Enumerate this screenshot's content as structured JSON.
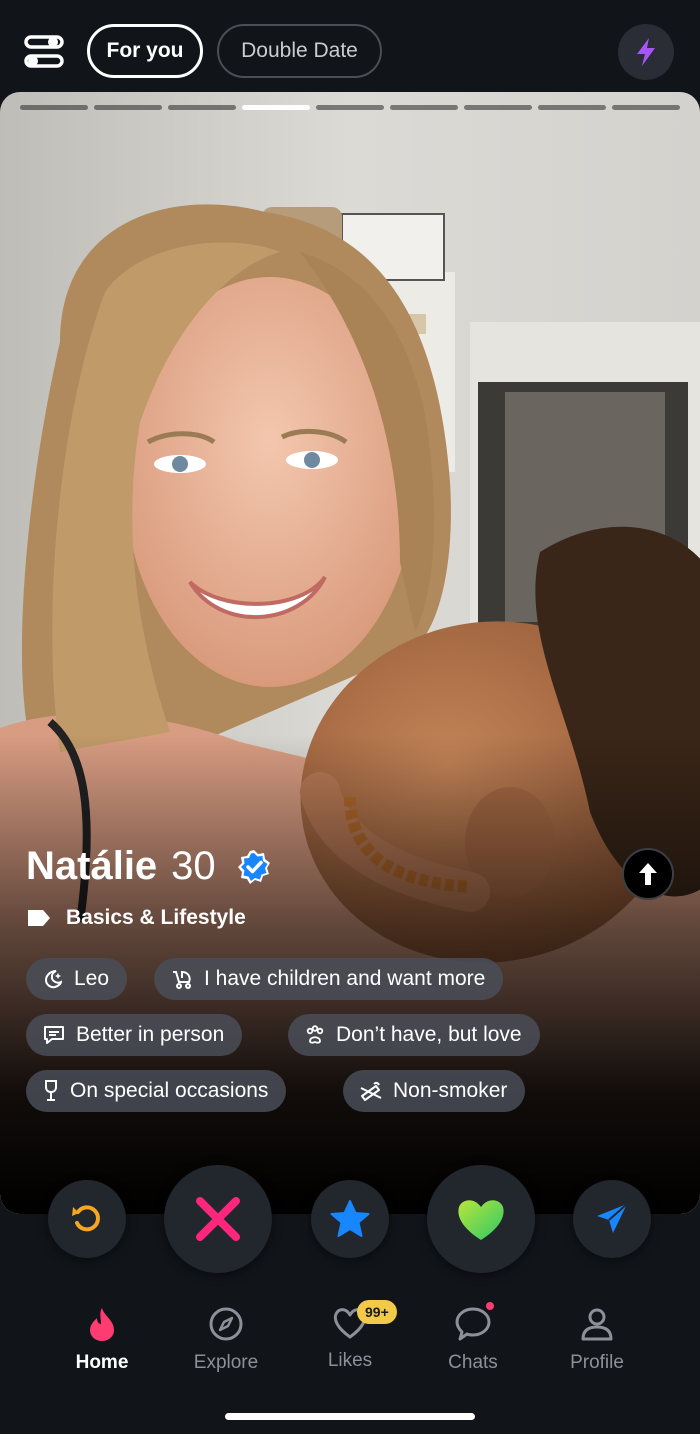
{
  "header": {
    "tabs": [
      {
        "label": "For you",
        "active": true
      },
      {
        "label": "Double Date",
        "active": false
      }
    ],
    "icons": {
      "filter": "sliders-icon",
      "boost": "lightning-icon"
    }
  },
  "profile": {
    "photo_count": 9,
    "current_photo": 4,
    "name": "Natálie",
    "age": "30",
    "verified": true,
    "section_label": "Basics & Lifestyle",
    "chips": [
      {
        "icon": "moon-icon",
        "label": "Leo"
      },
      {
        "icon": "stroller-icon",
        "label": "I have children and want more"
      },
      {
        "icon": "chat-bubble-icon",
        "label": "Better in person"
      },
      {
        "icon": "paw-icon",
        "label": "Don’t have, but love"
      },
      {
        "icon": "wine-glass-icon",
        "label": "On special occasions"
      },
      {
        "icon": "no-smoking-icon",
        "label": "Non-smoker"
      }
    ]
  },
  "actions": [
    "rewind-icon",
    "nope-icon",
    "super-like-icon",
    "like-icon",
    "boost-send-icon"
  ],
  "nav": {
    "items": [
      {
        "label": "Home",
        "icon": "flame-icon",
        "active": true
      },
      {
        "label": "Explore",
        "icon": "compass-icon",
        "active": false
      },
      {
        "label": "Likes",
        "icon": "heart-icon",
        "active": false,
        "badge": "99+"
      },
      {
        "label": "Chats",
        "icon": "chat-icon",
        "active": false,
        "dot": true
      },
      {
        "label": "Profile",
        "icon": "person-icon",
        "active": false
      }
    ]
  },
  "colors": {
    "background": "#111418",
    "nope": "#fd267d",
    "super_like": "#1786ff",
    "like": "#4cd964",
    "rewind": "#f5a623",
    "boost": "#a855f7",
    "tinder_flame": "#fe3c72",
    "badge": "#f3c94a",
    "verified": "#1786ff"
  }
}
